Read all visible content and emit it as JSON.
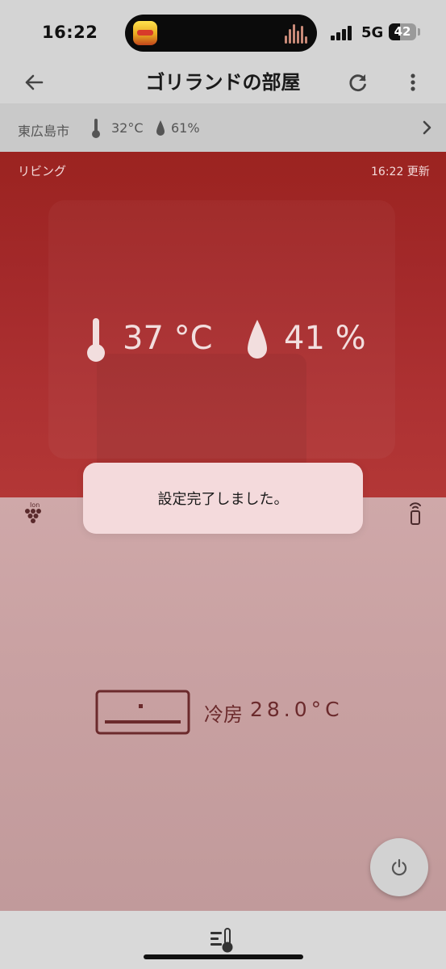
{
  "status_bar": {
    "time": "16:22",
    "network": "5G",
    "battery": "42",
    "battery_fraction": 0.42
  },
  "header": {
    "title": "ゴリランドの部屋",
    "back_icon": "arrow-left-icon",
    "refresh_icon": "refresh-icon",
    "more_icon": "more-vertical-icon"
  },
  "weather": {
    "city": "東広島市",
    "temperature": "32°C",
    "humidity": "61%"
  },
  "room": {
    "name": "リビング",
    "updated": "16:22 更新",
    "temperature": "37 °C",
    "humidity": "41 %"
  },
  "aircon": {
    "mode": "冷房",
    "setpoint": "28.0°C",
    "ion_icon": "ion-icon",
    "remote_icon": "remote-icon",
    "power_icon": "power-icon"
  },
  "toast": {
    "message": "設定完了しました。"
  },
  "colors": {
    "room_bg": "#a5292a",
    "ac_bg": "#c9a1a2",
    "ac_text": "#6b2a2c",
    "toast_bg": "#f4dadc"
  }
}
